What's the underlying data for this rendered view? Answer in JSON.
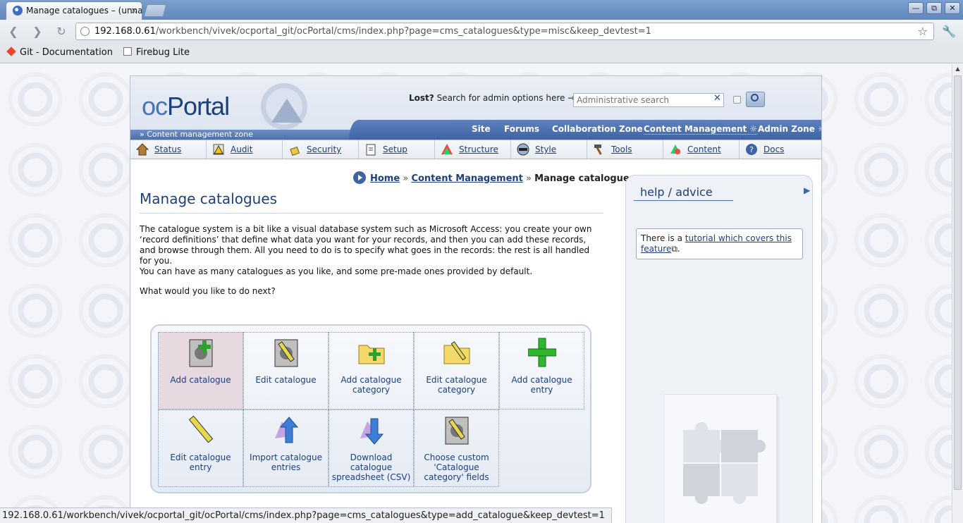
{
  "browser": {
    "tab_title": "Manage catalogues – (unna",
    "tab_close": "×",
    "url_host": "192.168.0.61",
    "url_path": "/workbench/vivek/ocportal_git/ocPortal/cms/index.php?page=cms_catalogues&type=misc&keep_devtest=1",
    "bookmarks": [
      "Git - Documentation",
      "Firebug Lite"
    ],
    "status_url": "192.168.0.61/workbench/vivek/ocportal_git/ocPortal/cms/index.php?page=cms_catalogues&type=add_catalogue&keep_devtest=1",
    "window_buttons": [
      "—",
      "⧉",
      "✕"
    ]
  },
  "header": {
    "logo_oc": "oc",
    "logo_portal": "Portal",
    "lost_label": "Lost?",
    "search_prompt": "Search for admin options here →",
    "search_placeholder": "Administrative search",
    "search_clear": "✕",
    "zone_label": "» Content management zone",
    "zones": [
      "Site",
      "Forums",
      "Collaboration Zone",
      "Content Management ☼",
      "Admin Zone ☼"
    ]
  },
  "menu": [
    "Status",
    "Audit",
    "Security",
    "Setup",
    "Structure",
    "Style",
    "Tools",
    "Content",
    "Docs"
  ],
  "breadcrumb": {
    "home": "Home",
    "sep1": "»",
    "section": "Content Management",
    "sep2": "»",
    "current": "Manage catalogues"
  },
  "main": {
    "title": "Manage catalogues",
    "intro": "The catalogue system is a bit like a visual database system such as Microsoft Access: you create your own ‘record definitions’ that define what data you want for your records, and then you can add these records, and browse through them. All you need to do is to specify what goes in the records: the rest is all handled for you.",
    "note": "You can have as many catalogues as you like, and some pre-made ones provided by default.",
    "question": "What would you like to do next?",
    "actions": [
      "Add catalogue",
      "Edit catalogue",
      "Add catalogue category",
      "Edit catalogue category",
      "Add catalogue entry",
      "Edit catalogue entry",
      "Import catalogue entries",
      "Download catalogue spreadsheet (CSV)",
      "Choose custom 'Catalogue category' fields"
    ]
  },
  "sidebar": {
    "title": "help / advice",
    "arrow": "▶",
    "text_before": "There is a ",
    "link": "tutorial which covers this feature",
    "text_after": "."
  }
}
